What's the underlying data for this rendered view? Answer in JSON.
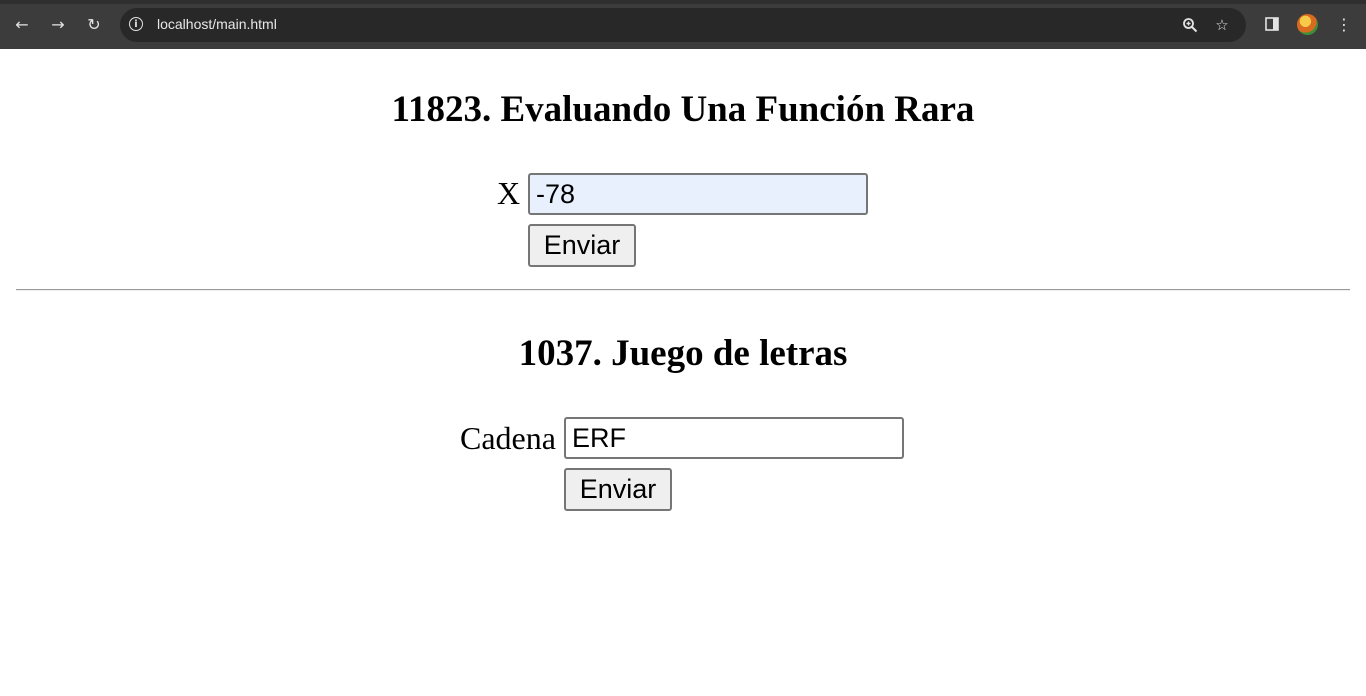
{
  "browser": {
    "url": "localhost/main.html",
    "icons": [
      "back-icon",
      "forward-icon",
      "reload-icon",
      "site-info-icon",
      "zoom-icon",
      "bookmark-star-icon",
      "side-panel-icon",
      "profile-avatar",
      "menu-kebab-icon"
    ]
  },
  "section1": {
    "title": "11823. Evaluando Una Función Rara",
    "input_label": "X",
    "input_value": "-78",
    "submit_label": "Enviar"
  },
  "section2": {
    "title": "1037. Juego de letras",
    "input_label": "Cadena",
    "input_value": "ERF",
    "submit_label": "Enviar"
  }
}
